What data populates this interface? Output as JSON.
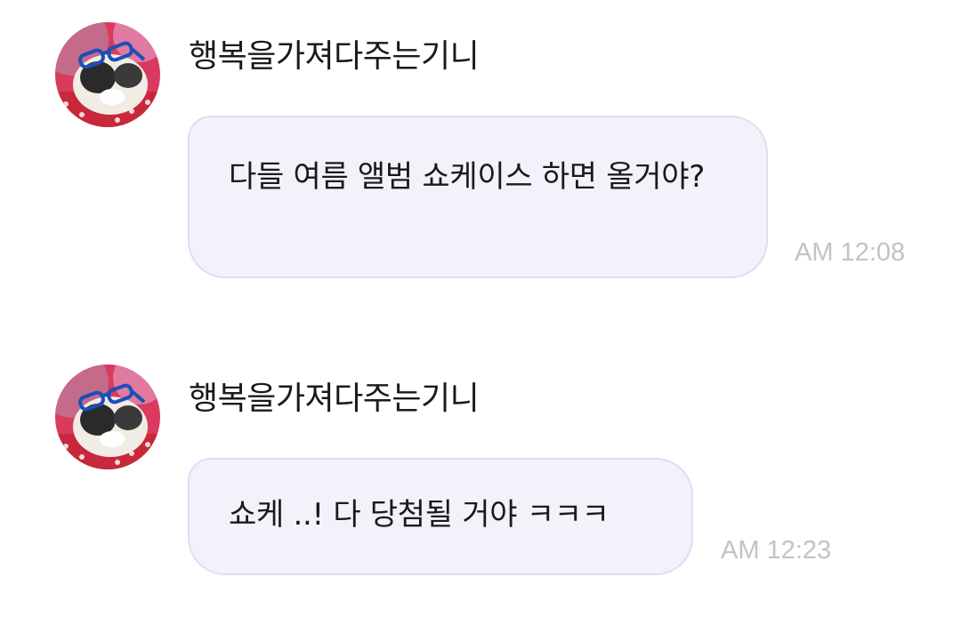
{
  "messages": [
    {
      "sender": "행복을가져다주는기니",
      "text": "다들 여름 앨범 쇼케이스 하면 올거야?",
      "time": "AM 12:08"
    },
    {
      "sender": "행복을가져다주는기니",
      "text": "쇼케 ..! 다 당첨될 거야 ㅋㅋㅋ",
      "time": "AM 12:23"
    }
  ],
  "colors": {
    "bubble_background": "#f3f2fa",
    "bubble_border": "#e1dcf3",
    "timestamp": "#c3c3c3",
    "text": "#1a1a1a"
  },
  "icons": {
    "avatar": "guinea-pig-with-sunglasses-avatar"
  }
}
